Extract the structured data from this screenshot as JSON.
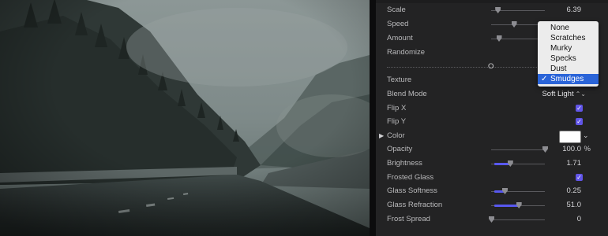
{
  "inspector": {
    "rows": {
      "scale": {
        "label": "Scale",
        "value": "6.39",
        "level": 0.12
      },
      "speed": {
        "label": "Speed",
        "level": 0.42
      },
      "amount": {
        "label": "Amount",
        "level": 0.14
      },
      "randomize": {
        "label": "Randomize"
      },
      "texture": {
        "label": "Texture"
      },
      "blend_mode": {
        "label": "Blend Mode",
        "value": "Soft Light"
      },
      "flip_x": {
        "label": "Flip X",
        "checked": true
      },
      "flip_y": {
        "label": "Flip Y",
        "checked": true
      },
      "color": {
        "label": "Color",
        "swatch": "#ffffff"
      },
      "opacity": {
        "label": "Opacity",
        "value": "100.0",
        "unit": "%",
        "level": 1.0
      },
      "brightness": {
        "label": "Brightness",
        "value": "1.71",
        "level": 0.35
      },
      "frosted_glass": {
        "label": "Frosted Glass",
        "checked": true
      },
      "glass_softness": {
        "label": "Glass Softness",
        "value": "0.25",
        "level": 0.25
      },
      "glass_refraction": {
        "label": "Glass Refraction",
        "value": "51.0",
        "level": 0.51
      },
      "frost_spread": {
        "label": "Frost Spread",
        "value": "0",
        "level": 0.0
      }
    },
    "partial_text": "O",
    "icons": {
      "select_arrows": "⌃⌄",
      "check": "✓",
      "disclosure": "▶",
      "chevron": "⌄"
    }
  },
  "texture_menu": {
    "items": [
      "None",
      "Scratches",
      "Murky",
      "Specks",
      "Dust",
      "Smudges"
    ],
    "selected": "Smudges"
  },
  "colors": {
    "accent": "#5858f0",
    "checkbox": "#6155e8",
    "menu_highlight": "#2a64d8",
    "panel": "#232324"
  }
}
